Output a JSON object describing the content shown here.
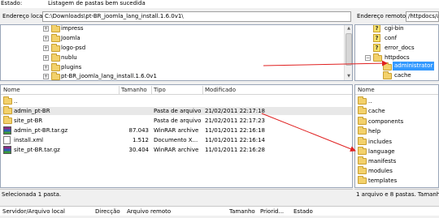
{
  "status_line": {
    "label": "Estado:",
    "message": "Listagem de pastas bem sucedida"
  },
  "local_path": {
    "label": "Endereço local:",
    "value": "C:\\Downloads\\pt-BR_joomla_lang_install.1.6.0v1\\"
  },
  "remote_path": {
    "label": "Endereço remoto:",
    "value": "/httpdocs/ad"
  },
  "local_tree": [
    {
      "name": "impress"
    },
    {
      "name": "Joomla"
    },
    {
      "name": "logo-psd"
    },
    {
      "name": "nublu"
    },
    {
      "name": "plugins"
    },
    {
      "name": "pt-BR_joomla_lang_install.1.6.0v1"
    }
  ],
  "remote_tree": [
    {
      "name": "cgi-bin",
      "icon": "question-folder-icon"
    },
    {
      "name": "conf",
      "icon": "question-folder-icon"
    },
    {
      "name": "error_docs",
      "icon": "question-folder-icon"
    },
    {
      "name": "httpdocs",
      "icon": "folder-icon"
    },
    {
      "name": "administrator",
      "icon": "folder-icon",
      "selected": true
    },
    {
      "name": "cache",
      "icon": "folder-icon"
    }
  ],
  "local_columns": {
    "name": "Nome",
    "size": "Tamanho",
    "type": "Tipo",
    "modified": "Modificado"
  },
  "local_files": [
    {
      "name": "..",
      "size": "",
      "type": "",
      "modified": "",
      "icon": "folder-icon"
    },
    {
      "name": "admin_pt-BR",
      "size": "",
      "type": "Pasta de arquivo",
      "modified": "21/02/2011 22:17:18",
      "icon": "folder-icon",
      "selected": true
    },
    {
      "name": "site_pt-BR",
      "size": "",
      "type": "Pasta de arquivo",
      "modified": "21/02/2011 22:17:23",
      "icon": "folder-icon"
    },
    {
      "name": "admin_pt-BR.tar.gz",
      "size": "87.043",
      "type": "WinRAR archive",
      "modified": "11/01/2011 22:16:18",
      "icon": "rar-icon"
    },
    {
      "name": "install.xml",
      "size": "1.512",
      "type": "Documento X...",
      "modified": "11/01/2011 22:16:14",
      "icon": "file-icon"
    },
    {
      "name": "site_pt-BR.tar.gz",
      "size": "30.404",
      "type": "WinRAR archive",
      "modified": "11/01/2011 22:16:28",
      "icon": "rar-icon"
    }
  ],
  "local_status": "Selecionada 1 pasta.",
  "remote_columns": {
    "name": "Nome"
  },
  "remote_files": [
    {
      "name": ".."
    },
    {
      "name": "cache"
    },
    {
      "name": "components"
    },
    {
      "name": "help"
    },
    {
      "name": "includes"
    },
    {
      "name": "language"
    },
    {
      "name": "manifests"
    },
    {
      "name": "modules"
    },
    {
      "name": "templates"
    }
  ],
  "remote_status": "1 arquivo e 8 pastas. Tamanho",
  "queue_columns": {
    "server_local": "Servidor/Arquivo local",
    "direction": "Direcção",
    "remote_file": "Arquivo remoto",
    "size": "Tamanho",
    "priority": "Priorid...",
    "status": "Estado"
  },
  "colors": {
    "annotation_arrow": "#e02020",
    "selection": "#3399ff"
  }
}
